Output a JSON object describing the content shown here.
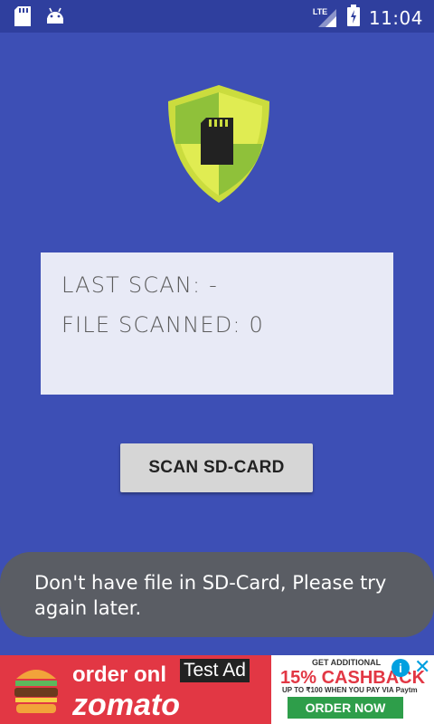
{
  "status_bar": {
    "time": "11:04",
    "network": "LTE",
    "icons": [
      "sd-card-icon",
      "android-icon",
      "signal-icon",
      "battery-icon"
    ]
  },
  "app": {
    "logo_icon": "shield-sd-card-icon",
    "info_card": {
      "last_scan": "LAST SCAN: -",
      "files_scanned": "FILE SCANNED: 0"
    },
    "scan_button_label": "SCAN SD-CARD"
  },
  "toast": {
    "message": "Don't have file in SD-Card, Please try again later."
  },
  "ad_banner": {
    "order_text": "order onl",
    "brand": "zomato",
    "test_label": "Test Ad",
    "get_additional": "GET ADDITIONAL",
    "cashback": "15% CASHBACK",
    "upto": "UP TO ₹100 WHEN YOU PAY VIA Paytm",
    "order_now": "ORDER NOW",
    "info_glyph": "i",
    "close_glyph": "✕"
  },
  "colors": {
    "background": "#3d4fb5",
    "status_bar": "#2f3f9e",
    "card": "#e8eaf6",
    "toast": "#5a5d64",
    "shield_outer": "#d8e84a",
    "shield_inner": "#9ccc3a"
  }
}
